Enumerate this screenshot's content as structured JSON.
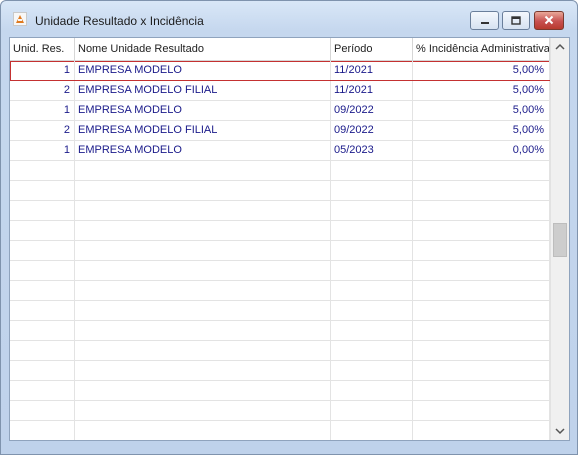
{
  "window": {
    "title": "Unidade Resultado x Incidência",
    "controls": {
      "minimize": "minimize",
      "maximize": "maximize",
      "close": "close"
    }
  },
  "grid": {
    "columns": [
      "Unid. Res.",
      "Nome Unidade Resultado",
      "Período",
      "% Incidência Administrativa"
    ],
    "rows": [
      {
        "unid": "1",
        "nome": "EMPRESA MODELO",
        "periodo": "11/2021",
        "incidencia": "5,00%"
      },
      {
        "unid": "2",
        "nome": "EMPRESA MODELO FILIAL",
        "periodo": "11/2021",
        "incidencia": "5,00%"
      },
      {
        "unid": "1",
        "nome": "EMPRESA MODELO",
        "periodo": "09/2022",
        "incidencia": "5,00%"
      },
      {
        "unid": "2",
        "nome": "EMPRESA MODELO FILIAL",
        "periodo": "09/2022",
        "incidencia": "5,00%"
      },
      {
        "unid": "1",
        "nome": "EMPRESA MODELO",
        "periodo": "05/2023",
        "incidencia": "0,00%"
      }
    ],
    "selected_row": 0,
    "empty_rows": 14
  },
  "colors": {
    "cell_text": "#1a1a8a",
    "selection_border": "#c43131",
    "close_button": "#c75050"
  }
}
